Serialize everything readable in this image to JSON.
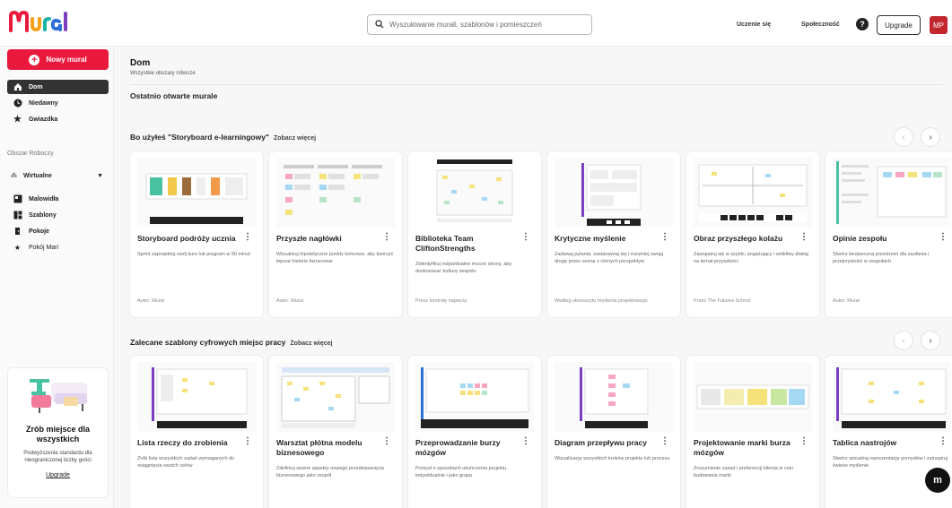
{
  "brand": {
    "name": "Mural"
  },
  "topbar": {
    "search_placeholder": "Wyszukiwanie murali, szablonów i pomieszczeń",
    "learn": "Uczenie się",
    "community": "Społeczność",
    "help": "?",
    "upgrade": "Upgrade",
    "avatar": "MP"
  },
  "sidebar": {
    "new_mural": "Nowy mural",
    "nav": [
      {
        "label": "Dom",
        "icon": "home-icon"
      },
      {
        "label": "Niedawny",
        "icon": "clock-icon"
      },
      {
        "label": "Gwiazdka",
        "icon": "star-icon"
      }
    ],
    "section_label": "Obszar Roboczy",
    "workspace": "Wirtualne",
    "ws_nav": [
      {
        "label": "Malowidła",
        "icon": "mural-icon"
      },
      {
        "label": "Szablony",
        "icon": "templates-icon"
      },
      {
        "label": "Pokoje",
        "icon": "door-icon"
      },
      {
        "label": "Pokój Mari",
        "icon": "star-icon"
      }
    ],
    "promo": {
      "title": "Zrób miejsce dla wszystkich",
      "text": "Podwyższenie standardu dla nieograniczonej liczby gości",
      "link": "Upgrade"
    }
  },
  "main": {
    "title": "Dom",
    "subtitle": "Wszystkie obszary robocze",
    "recent": "Ostatnio otwarte murale",
    "section1": {
      "title": "Bo użyłeś \"Storyboard e-learningowy\"",
      "more": "Zobacz więcej",
      "cards": [
        {
          "title": "Storyboard podróży ucznia",
          "desc": "Sprint zaprojektuj swój kurs lub program w 90 minut",
          "author": "Autor: Mural"
        },
        {
          "title": "Przyszłe nagłówki",
          "desc": "Wizualizuj hipotetyczne punkty końcowe, aby tworzyć lepsze historie biznesowe",
          "author": "Autor: Mural"
        },
        {
          "title": "Biblioteka Team CliftonStrengths",
          "desc": "Zidentyfikuj indywidualne mocne strony, aby dostosować kulturę zespołu",
          "author": "Przez kontrolę napięcia"
        },
        {
          "title": "Krytyczne myślenie",
          "desc": "Zadawaj pytania, zastanawiaj się i rozumiej swoją drogę przez ocenę z różnych perspektyw",
          "author": "Według skoroszytu myślenia projektowego"
        },
        {
          "title": "Obraz przyszłego kolażu",
          "desc": "Zaangażuj się w szybki, angażujący i wnikliwy dialog na temat przyszłości",
          "author": "Przez The Futures School"
        },
        {
          "title": "Opinie zespołu",
          "desc": "Stwórz bezpieczną przestrzeń dla zaufania i przejrzystości w zespołach",
          "author": "Autor: Mural"
        }
      ]
    },
    "section2": {
      "title": "Zalecane szablony cyfrowych miejsc pracy",
      "more": "Zobacz więcej",
      "cards": [
        {
          "title": "Lista rzeczy do zrobienia",
          "desc": "Zrób listę wszystkich zadań wymaganych do osiągnięcia swoich celów"
        },
        {
          "title": "Warsztat płótna modelu biznesowego",
          "desc": "Zdefiniuj ważne aspekty nowego przedsięwzięcia biznesowego jako zespół"
        },
        {
          "title": "Przeprowadzanie burzy mózgów",
          "desc": "Pomysł o sposobach ukończenia projektu, indywidualnie i jako grupa"
        },
        {
          "title": "Diagram przepływu pracy",
          "desc": "Wizualizacja wszystkich kroków projektu lub procesu"
        },
        {
          "title": "Projektowanie marki burza mózgów",
          "desc": "Zrozumienie zasad i preferencji klienta w celu budowania marki"
        },
        {
          "title": "Tablica nastrojów",
          "desc": "Stwórz wizualną reprezentację pomysłów i zainspiruj świeże myślenie"
        }
      ]
    }
  }
}
